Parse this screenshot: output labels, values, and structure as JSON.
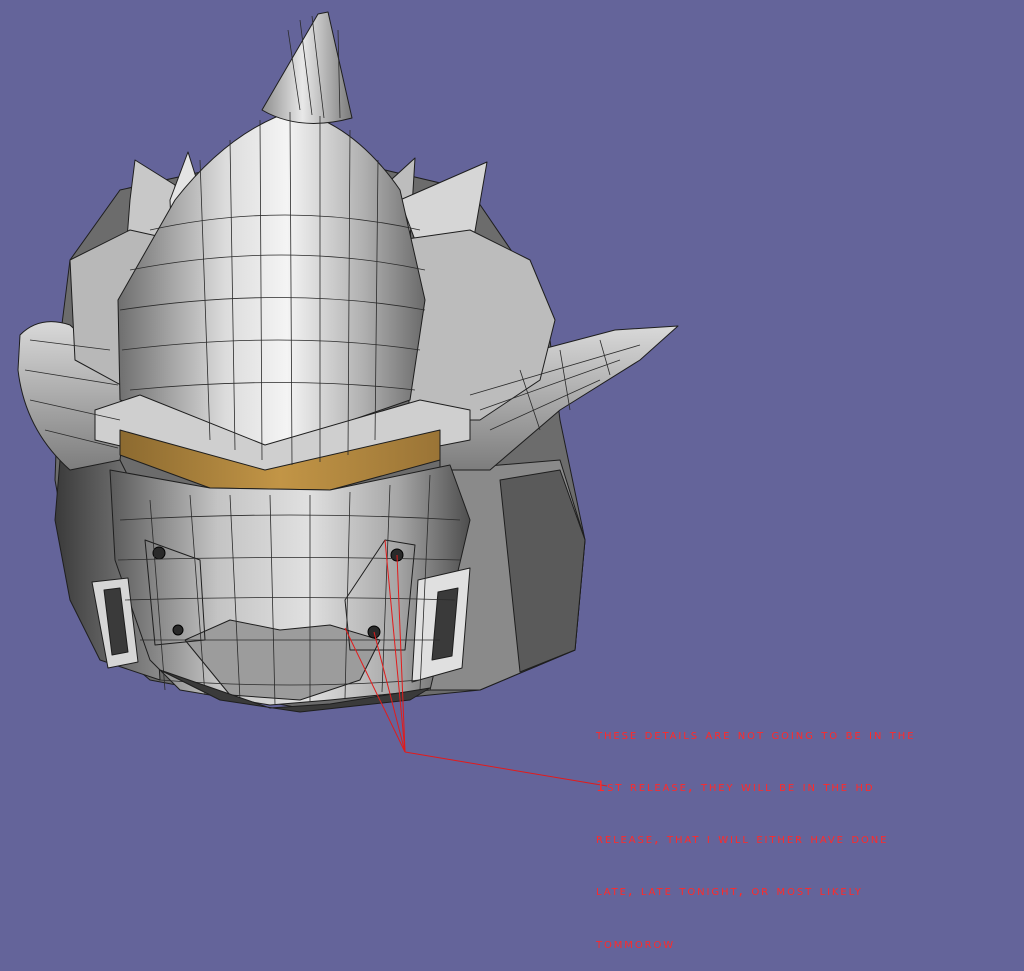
{
  "viewport": {
    "background_color": "#64649a",
    "model_name": "helmet-mesh",
    "wire_color": "#1e1e1e",
    "shade_colors": [
      "#ffffff",
      "#e6e6e6",
      "#cfcfcf",
      "#b4b4b4",
      "#9a9a9a",
      "#7e7e7e",
      "#5e5e5e",
      "#3e3e3e"
    ],
    "visor_color": "#b58a3e",
    "line_color": "#e21b1b"
  },
  "annotation": {
    "color": "#ff2a2a",
    "lines": [
      "These details are not going to be in the",
      "1st release, they will be in the HD",
      "release, that I will either have done",
      "late, late tonight, or most likely",
      "tommorow"
    ]
  }
}
